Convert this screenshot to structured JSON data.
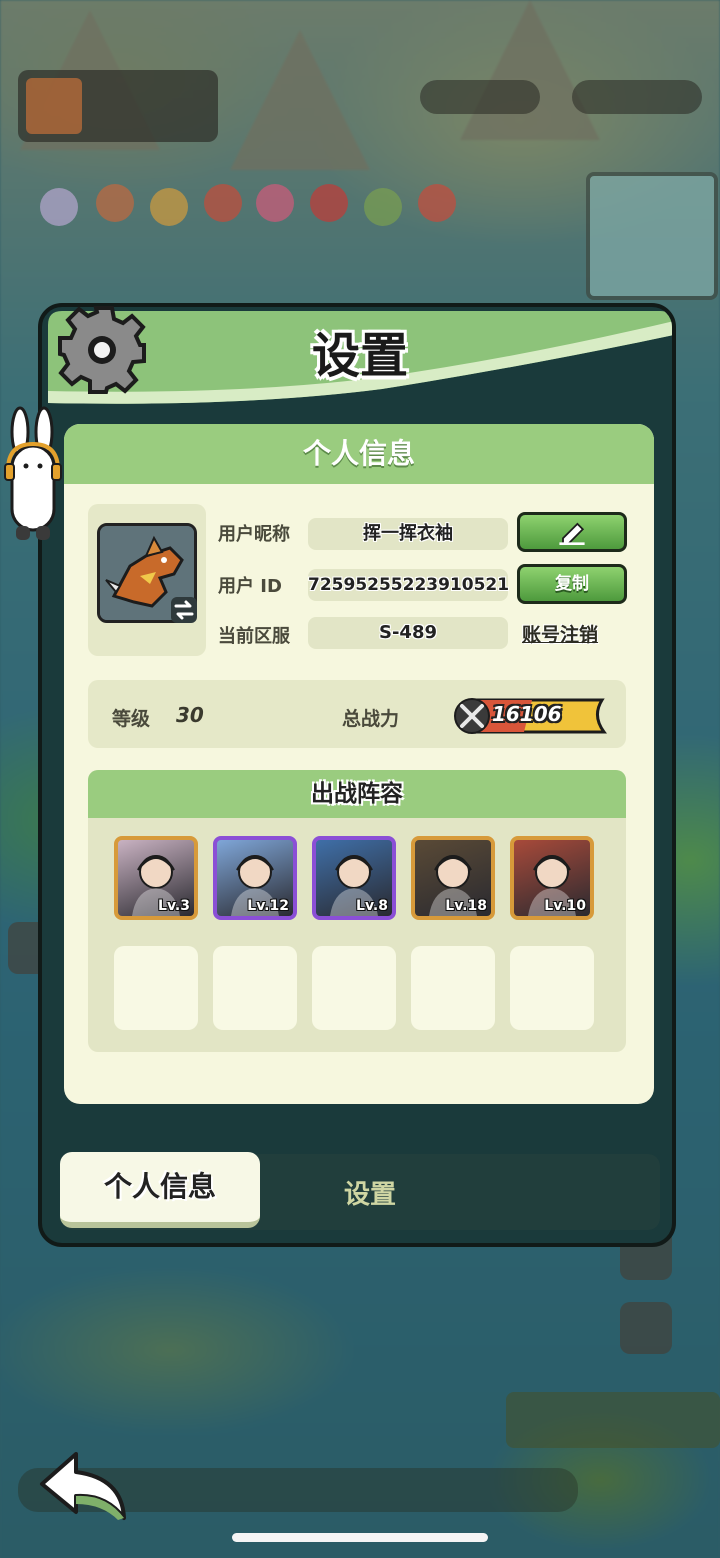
{
  "modal": {
    "title": "设置"
  },
  "profile": {
    "section_title": "个人信息",
    "nickname_label": "用户昵称",
    "nickname_value": "挥一挥衣袖",
    "id_label": "用户 ID",
    "id_value": "72595255223910521",
    "server_label": "当前区服",
    "server_value": "S-489",
    "copy_label": "复制",
    "logout_label": "账号注销",
    "edit_icon": "pencil-icon",
    "swap_icon": "swap-icon"
  },
  "stats": {
    "level_label": "等级",
    "level_value": "30",
    "power_label": "总战力",
    "power_value": "16106"
  },
  "lineup": {
    "title": "出战阵容",
    "heroes": [
      {
        "level": "Lv.3",
        "rarity": "gold",
        "color": "#c9b2c2"
      },
      {
        "level": "Lv.12",
        "rarity": "purple",
        "color": "#7fa6d8"
      },
      {
        "level": "Lv.8",
        "rarity": "purple",
        "color": "#3f6fa8"
      },
      {
        "level": "Lv.18",
        "rarity": "gold",
        "color": "#5a4a36"
      },
      {
        "level": "Lv.10",
        "rarity": "gold",
        "color": "#a84a3a"
      }
    ],
    "empty_slots": 5
  },
  "tabs": {
    "active": "个人信息",
    "inactive": "设置"
  },
  "colors": {
    "header_green": "#8dc37a",
    "panel_bg": "#f6f7de",
    "button_green": "#4e9a3d",
    "modal_dark": "#1a3a3b"
  }
}
